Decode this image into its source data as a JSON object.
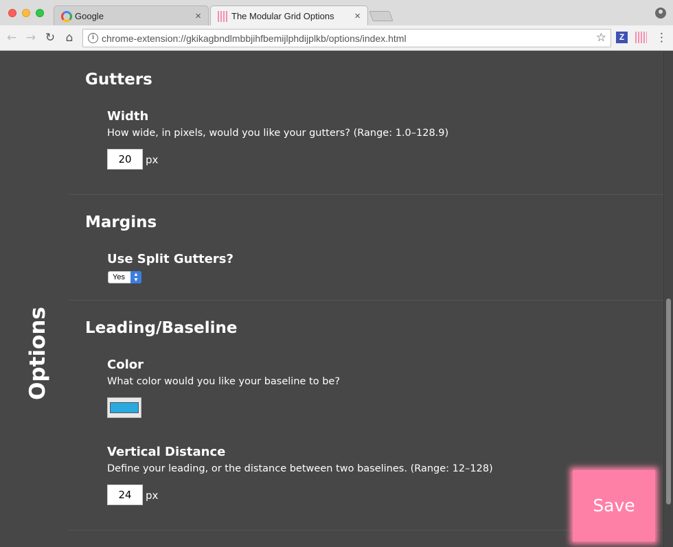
{
  "browser": {
    "tabs": [
      {
        "label": "Google",
        "close": "×"
      },
      {
        "label": "The Modular Grid Options",
        "close": "×"
      }
    ],
    "url": "chrome-extension://gkikagbndlmbbjihfbemijlphdijplkb/options/index.html",
    "extensions": {
      "z_label": "Z"
    }
  },
  "page": {
    "side_title": "Options",
    "sections": {
      "gutters": {
        "title": "Gutters",
        "width": {
          "label": "Width",
          "description": "How wide, in pixels, would you like your gutters? (Range: 1.0–128.9)",
          "value": "20",
          "unit": "px"
        }
      },
      "margins": {
        "title": "Margins",
        "split": {
          "label": "Use Split Gutters?",
          "value": "Yes"
        }
      },
      "leading": {
        "title": "Leading/Baseline",
        "color": {
          "label": "Color",
          "description": "What color would you like your baseline to be?",
          "value": "#29a9e0"
        },
        "distance": {
          "label": "Vertical Distance",
          "description": "Define your leading, or the distance between two baselines. (Range: 12–128)",
          "value": "24",
          "unit": "px"
        }
      }
    },
    "save_label": "Save"
  },
  "colors": {
    "background": "#474747",
    "save_button": "#ff80a6",
    "baseline_color": "#29a9e0"
  }
}
